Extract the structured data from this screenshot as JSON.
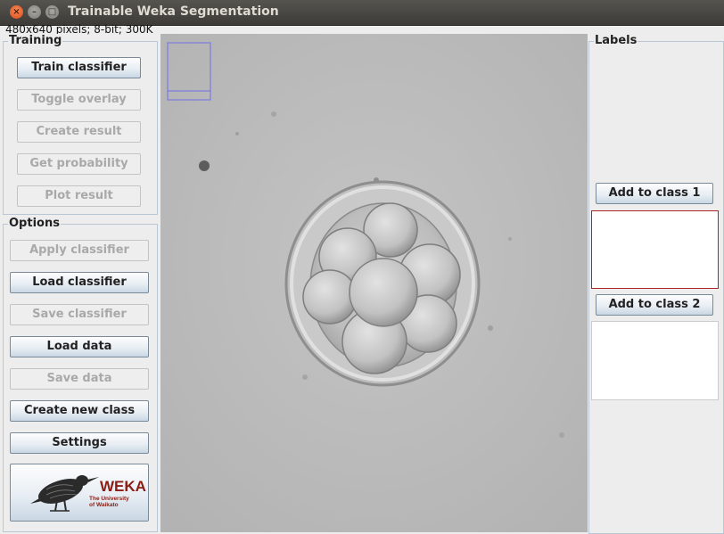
{
  "window": {
    "title": "Trainable Weka Segmentation",
    "info": "480x640 pixels; 8-bit; 300K"
  },
  "training": {
    "legend": "Training",
    "buttons": [
      {
        "label": "Train classifier",
        "enabled": true
      },
      {
        "label": "Toggle overlay",
        "enabled": false
      },
      {
        "label": "Create result",
        "enabled": false
      },
      {
        "label": "Get probability",
        "enabled": false
      },
      {
        "label": "Plot result",
        "enabled": false
      }
    ]
  },
  "options": {
    "legend": "Options",
    "buttons": [
      {
        "label": "Apply classifier",
        "enabled": false
      },
      {
        "label": "Load classifier",
        "enabled": true
      },
      {
        "label": "Save classifier",
        "enabled": false
      },
      {
        "label": "Load data",
        "enabled": true
      },
      {
        "label": "Save data",
        "enabled": false
      },
      {
        "label": "Create new class",
        "enabled": true
      },
      {
        "label": "Settings",
        "enabled": true
      }
    ],
    "logo": {
      "name": "WEKA",
      "line1": "The University",
      "line2": "of Waikato"
    }
  },
  "labels": {
    "legend": "Labels",
    "class1_button": "Add to class 1",
    "class2_button": "Add to class 2",
    "class1_color": "#b22222",
    "class2_color": "#cccccc"
  }
}
